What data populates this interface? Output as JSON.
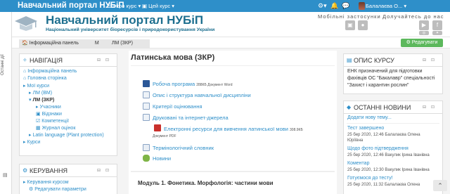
{
  "topbar": {
    "brand": "Навчальний портал НУБіП",
    "menu_info": "Інфо курс",
    "menu_this": "Цей курс",
    "username": "Балалаєва О...",
    "icon_gear": "gear-icon",
    "icon_bell": "bell-icon",
    "icon_chat": "chat-icon"
  },
  "sidetab": {
    "label": "Останні дії"
  },
  "header": {
    "title": "Навчальний портал НУБіП",
    "subtitle": "Національний університет біоресурсів і природокористування України",
    "mobile_label": "Мобільні застосунки",
    "join_label": "Долучайтесь до нас"
  },
  "breadcrumb": {
    "items": [
      "Інформаційна панель",
      "М",
      "ЛМ (ЗКР)"
    ]
  },
  "edit_button": "Редагувати",
  "nav_block": {
    "title": "НАВІГАЦІЯ",
    "items": [
      "Інформаційна панель",
      "Головна сторінка",
      "Мої курси",
      "ЛМ (ВМ)",
      "ЛМ (ЗКР)",
      "Учасники",
      "Відзнаки",
      "Компетенції",
      "Журнал оцінок",
      "Latin language (Plant protection)",
      "Курси"
    ]
  },
  "admin_block": {
    "title": "КЕРУВАННЯ",
    "items": [
      "Керування курсом",
      "Редагувати параметри"
    ]
  },
  "main": {
    "title": "Латинська мова (ЗКР)",
    "resources": [
      {
        "label": "Робоча програма",
        "meta": "288КБ Документ Word"
      },
      {
        "label": "Опис і структура навчальної дисципліни",
        "meta": ""
      },
      {
        "label": "Критерії оцінювання",
        "meta": ""
      },
      {
        "label": "Друковані та інтернет-джерела",
        "meta": ""
      },
      {
        "label": "Електронні ресурси для вивчення латинської мови",
        "meta": "308.9КБ"
      },
      {
        "label": "Документ PDF",
        "meta": ""
      },
      {
        "label": "Термінологічний словник",
        "meta": ""
      },
      {
        "label": "Новини",
        "meta": ""
      }
    ],
    "module": "Модуль 1. Фонетика. Морфологія: частини мови"
  },
  "course_desc": {
    "title": "ОПИС КУРСУ",
    "lines": [
      "ЕНК призначений для підготовки",
      "фахівців ОС \"Бакалавр\" спеціальності",
      "\"Захист і карантин рослин\""
    ]
  },
  "news": {
    "title": "ОСТАННІ НОВИНИ",
    "add": "Додати нову тему...",
    "posts": [
      {
        "title": "Тест завершено",
        "meta1": "25 бер 2020, 12:46 Балалаєва Олена",
        "meta2": "Юріївна"
      },
      {
        "title": "Щодо фото підтвердження",
        "meta1": "25 бер 2020, 12:46 Вакулик Ірина Іванівна",
        "meta2": ""
      },
      {
        "title": "Коментар",
        "meta1": "25 бер 2020, 12:30 Вакулик Ірина Іванівна",
        "meta2": ""
      },
      {
        "title": "Готуємося до тесту!",
        "meta1": "25 бер 2020, 11:32 Балалаєва Олена",
        "meta2": ""
      }
    ]
  }
}
